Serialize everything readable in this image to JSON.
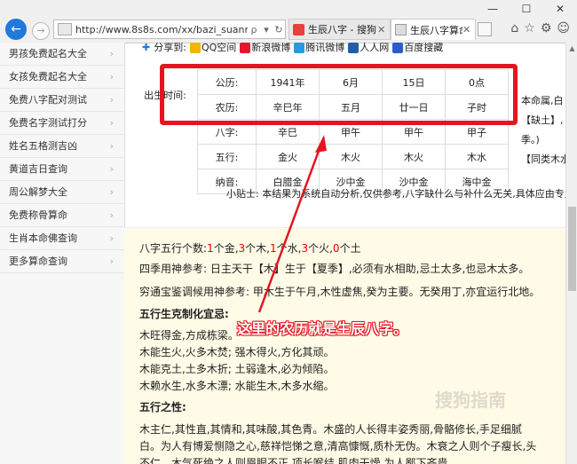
{
  "browser": {
    "window_controls": [
      "—",
      "☐",
      "✕"
    ],
    "url": "http://www.8s8s.com/xx/bazi_suanming.p",
    "url_icons": [
      "ρ",
      "▾",
      "↻"
    ],
    "tabs": [
      {
        "label": "生辰八字 - 搜狗...",
        "close": "✕"
      },
      {
        "label": "生辰八字算命...",
        "close": "✕"
      }
    ]
  },
  "sidebar": {
    "items": [
      {
        "label": "男孩免费起名大全"
      },
      {
        "label": "女孩免费起名大全"
      },
      {
        "label": "免费八字配对测试"
      },
      {
        "label": "免费名字测试打分"
      },
      {
        "label": "姓名五格测吉凶"
      },
      {
        "label": "黄道吉日查询"
      },
      {
        "label": "周公解梦大全"
      },
      {
        "label": "免费称骨算命"
      },
      {
        "label": "生肖本命佛查询"
      },
      {
        "label": "更多算命查询"
      }
    ]
  },
  "share": {
    "label": "分享到:",
    "targets": [
      "QQ空间",
      "新浪微博",
      "腾讯微博",
      "人人网",
      "百度搜藏"
    ]
  },
  "birth": {
    "label": "出生时间:",
    "rows": [
      {
        "type": "公历:",
        "cells": [
          "1941年",
          "6月",
          "15日",
          "0点"
        ]
      },
      {
        "type": "农历:",
        "cells": [
          "辛巳年",
          "五月",
          "廿一日",
          "子时"
        ]
      }
    ]
  },
  "bazi": {
    "rows": [
      {
        "type": "八字:",
        "cells": [
          "辛巳",
          "甲午",
          "甲午",
          "甲子"
        ]
      },
      {
        "type": "五行:",
        "cells": [
          "金火",
          "木火",
          "木火",
          "木水"
        ]
      },
      {
        "type": "纳音:",
        "cells": [
          "白腊金",
          "沙中金",
          "沙中金",
          "海中金"
        ]
      }
    ]
  },
  "side_note": [
    "本命属,白",
    "【缺土】,",
    "季。)",
    "【同类木水"
  ],
  "tip": "小贴士: 本结果为系统自动分析,仅供参考,八字缺什么与补什么无关,具体应由专业",
  "analysis": {
    "count_prefix": "八字五行个数:",
    "counts": [
      {
        "num": "1",
        "elem": "个金,"
      },
      {
        "num": "3",
        "elem": "个木,"
      },
      {
        "num": "1",
        "elem": "个水,"
      },
      {
        "num": "3",
        "elem": "个火,"
      },
      {
        "num": "0",
        "elem": "个土"
      }
    ],
    "season": "四季用神参考: 日主天干【木】生于【夏季】,必须有水相助,忌土太多,也忌木太多。",
    "qiongtong": "穷通宝鉴调候用神参考: 甲木生于午月,木性虚焦,癸为主要。无癸用丁,亦宜运行北地。",
    "ke_heading": "五行生克制化宜忌:",
    "ke_lines": [
      "木旺得金,方成栋梁。",
      "木能生火,火多木焚; 强木得火,方化其顽。",
      "木能克土,土多木折; 土弱逢木,必为倾陷。",
      "木赖水生,水多木漂; 水能生木,木多水缩。"
    ],
    "nature_heading": "五行之性:",
    "nature_lines": [
      "木主仁,其性直,其情和,其味酸,其色青。木盛的人长得丰姿秀丽,骨骼修长,手足细腻",
      "白。为人有博爱恻隐之心,慈祥恺悌之意,清高慷慨,质朴无伪。木衰之人则个子瘦长,头",
      "不仁。木气死绝之人则眉眼不正,项长喉结,肌肉干燥,为人鄙下吝啬。"
    ]
  },
  "annotation": "这里的农历就是生辰八字。",
  "watermark": "搜狗指南"
}
